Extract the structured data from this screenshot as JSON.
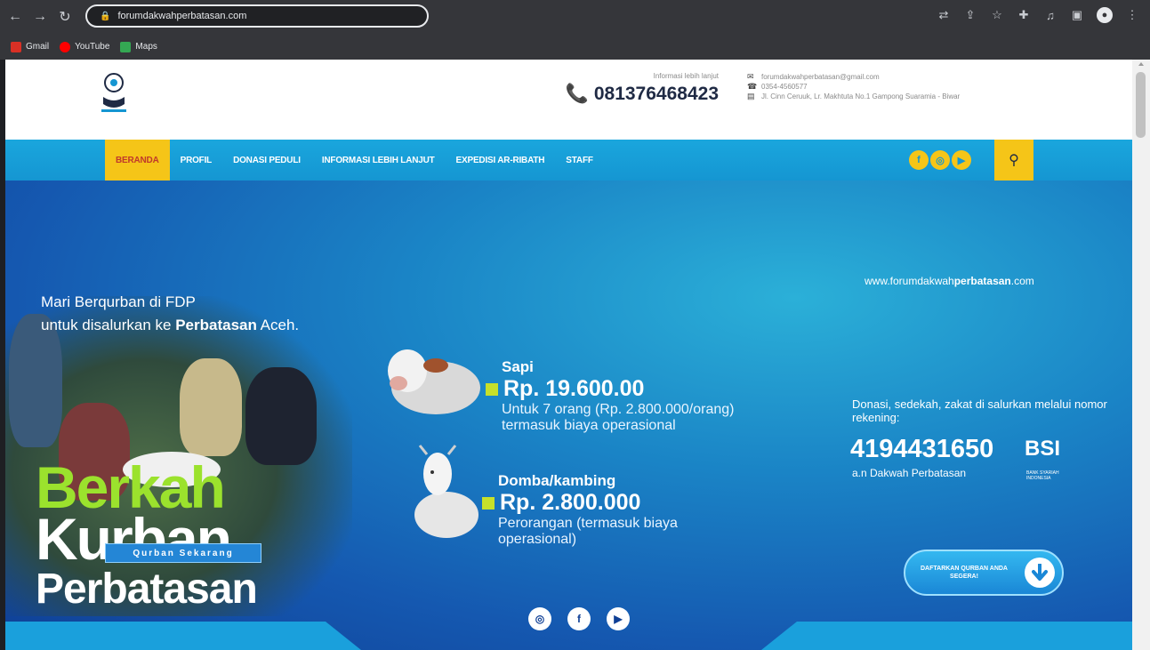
{
  "browser": {
    "url": "forumdakwahperbatasan.com",
    "bookmarks": [
      {
        "label": "Gmail",
        "color": "#d93025"
      },
      {
        "label": "YouTube",
        "color": "#ff0000"
      },
      {
        "label": "Maps",
        "color": "#34a853"
      }
    ]
  },
  "header": {
    "hotline_caption": "Informasi lebih lanjut",
    "hotline_number": "081376468423",
    "contact": {
      "email": "forumdakwahperbatasan@gmail.com",
      "phone": "0354-4560577",
      "address": "Jl. Cinn Ceruuk, Lr. Makhtuta No.1 Gampong Suaramia - Biwar"
    }
  },
  "nav": {
    "items": [
      "BERANDA",
      "PROFIL",
      "DONASI PEDULI",
      "INFORMASI LEBIH LANJUT",
      "EXPEDISI AR-RIBATH",
      "STAFF"
    ],
    "active_index": 0,
    "social": [
      "f",
      "◎",
      "▶"
    ],
    "search_icon": "⚲"
  },
  "banner": {
    "promo_line1": "Mari Berqurban di FDP",
    "promo_line2_prefix": "untuk disalurkan ke ",
    "promo_line2_bold": "Perbatasan",
    "promo_line2_suffix": " Aceh.",
    "title_word1": "Berkah",
    "title_word2": "Kurban",
    "title_word3": "Perbatasan",
    "cta_button": "Qurban Sekarang",
    "site_url_prefix": "www.forumdakwah",
    "site_url_bold": "perbatasan",
    "site_url_suffix": ".com",
    "offers": [
      {
        "name": "Sapi",
        "price": "Rp. 19.600.00",
        "note_line1": "Untuk 7 orang (Rp. 2.800.000/orang)",
        "note_line2": "termasuk biaya operasional"
      },
      {
        "name": "Domba/kambing",
        "price": "Rp. 2.800.000",
        "note_line1": "Perorangan (termasuk biaya",
        "note_line2": "operasional)"
      }
    ],
    "donation_text": "Donasi, sedekah, zakat di salurkan melalui nomor rekening:",
    "account_number": "4194431650",
    "account_holder": "a.n Dakwah Perbatasan",
    "bank_name": "BSI",
    "bank_sub": "BANK SYARIAH INDONESIA",
    "register_button": "DAFTARKAN QURBAN ANDA SEGERA!",
    "social": [
      "◎",
      "f",
      "▶"
    ]
  },
  "colors": {
    "nav_blue": "#1596d2",
    "accent_yellow": "#f5c518",
    "lime": "#9be22d",
    "banner_dark": "#0f3f95"
  }
}
